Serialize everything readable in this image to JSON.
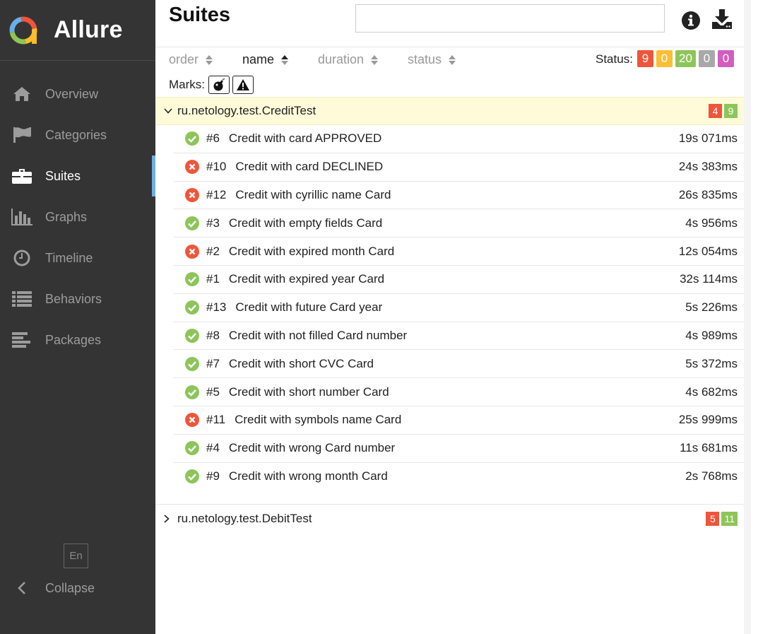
{
  "app": {
    "name": "Allure"
  },
  "sidebar": {
    "items": [
      {
        "label": "Overview",
        "icon": "home-icon",
        "active": false
      },
      {
        "label": "Categories",
        "icon": "flag-icon",
        "active": false
      },
      {
        "label": "Suites",
        "icon": "briefcase-icon",
        "active": true
      },
      {
        "label": "Graphs",
        "icon": "bar-chart-icon",
        "active": false
      },
      {
        "label": "Timeline",
        "icon": "clock-icon",
        "active": false
      },
      {
        "label": "Behaviors",
        "icon": "list-icon",
        "active": false
      },
      {
        "label": "Packages",
        "icon": "align-left-icon",
        "active": false
      }
    ],
    "language": "En",
    "collapse_label": "Collapse"
  },
  "header": {
    "title": "Suites",
    "search_value": ""
  },
  "sort": {
    "order": "order",
    "name": "name",
    "duration": "duration",
    "status": "status"
  },
  "status_filter": {
    "label": "Status:",
    "badges": [
      {
        "value": "9",
        "color": "#ef553b"
      },
      {
        "value": "0",
        "color": "#fcbf33"
      },
      {
        "value": "20",
        "color": "#8dc559"
      },
      {
        "value": "0",
        "color": "#a8a8a8"
      },
      {
        "value": "0",
        "color": "#d35ebe"
      }
    ]
  },
  "marks": {
    "label": "Marks:"
  },
  "colors": {
    "passed": "#8dc559",
    "failed": "#ef553b",
    "active_accent": "#6eaee7"
  },
  "suites": [
    {
      "name": "ru.netology.test.CreditTest",
      "failed": "4",
      "passed": "9",
      "expanded": true,
      "tests": [
        {
          "status": "passed",
          "num": "#6",
          "name": "Credit with card APPROVED",
          "duration": "19s 071ms"
        },
        {
          "status": "failed",
          "num": "#10",
          "name": "Credit with card DECLINED",
          "duration": "24s 383ms"
        },
        {
          "status": "failed",
          "num": "#12",
          "name": "Credit with cyrillic name Card",
          "duration": "26s 835ms"
        },
        {
          "status": "passed",
          "num": "#3",
          "name": "Credit with empty fields Card",
          "duration": "4s 956ms"
        },
        {
          "status": "failed",
          "num": "#2",
          "name": "Credit with expired month Card",
          "duration": "12s 054ms"
        },
        {
          "status": "passed",
          "num": "#1",
          "name": "Credit with expired year Card",
          "duration": "32s 114ms"
        },
        {
          "status": "passed",
          "num": "#13",
          "name": "Credit with future Card year",
          "duration": "5s 226ms"
        },
        {
          "status": "passed",
          "num": "#8",
          "name": "Credit with not filled Card number",
          "duration": "4s 989ms"
        },
        {
          "status": "passed",
          "num": "#7",
          "name": "Credit with short CVC Card",
          "duration": "5s 372ms"
        },
        {
          "status": "passed",
          "num": "#5",
          "name": "Credit with short number Card",
          "duration": "4s 682ms"
        },
        {
          "status": "failed",
          "num": "#11",
          "name": "Credit with symbols name Card",
          "duration": "25s 999ms"
        },
        {
          "status": "passed",
          "num": "#4",
          "name": "Credit with wrong Card number",
          "duration": "11s 681ms"
        },
        {
          "status": "passed",
          "num": "#9",
          "name": "Credit with wrong month Card",
          "duration": "2s 768ms"
        }
      ]
    },
    {
      "name": "ru.netology.test.DebitTest",
      "failed": "5",
      "passed": "11",
      "expanded": false,
      "tests": []
    }
  ]
}
